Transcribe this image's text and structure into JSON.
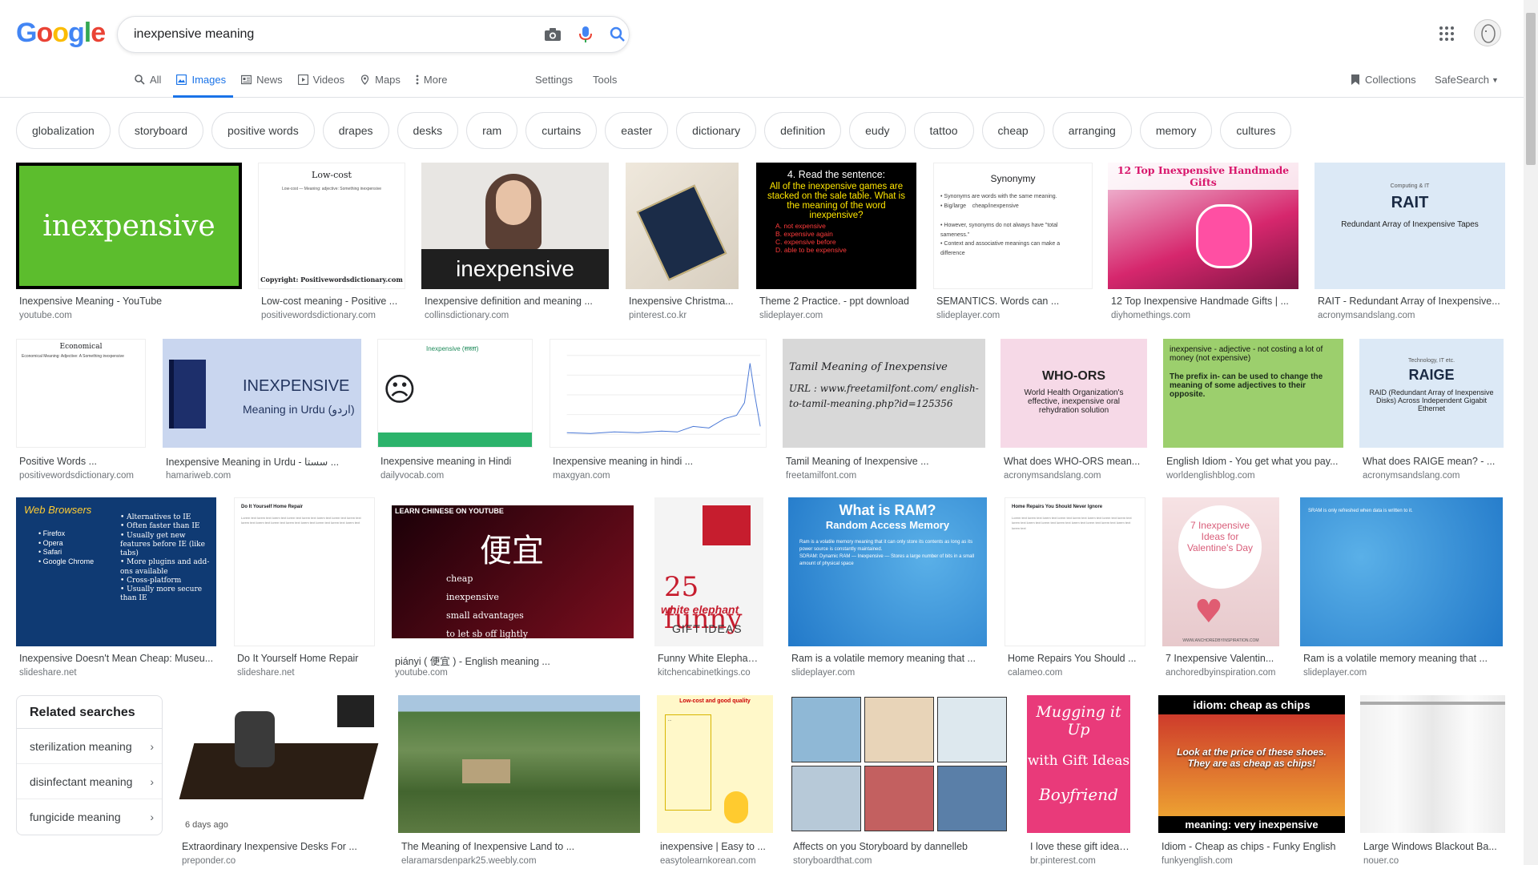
{
  "logo_letters": [
    "G",
    "o",
    "o",
    "g",
    "l",
    "e"
  ],
  "logo_colors": [
    "#4285F4",
    "#EA4335",
    "#FBBC05",
    "#4285F4",
    "#34A853",
    "#EA4335"
  ],
  "search": {
    "value": "inexpensive meaning"
  },
  "tabs": [
    {
      "label": "All",
      "icon": "search-icon",
      "active": false
    },
    {
      "label": "Images",
      "icon": "image-icon",
      "active": true
    },
    {
      "label": "News",
      "icon": "news-icon",
      "active": false
    },
    {
      "label": "Videos",
      "icon": "video-icon",
      "active": false
    },
    {
      "label": "Maps",
      "icon": "map-icon",
      "active": false
    },
    {
      "label": "More",
      "icon": "more-vert-icon",
      "active": false
    }
  ],
  "settings_label": "Settings",
  "tools_label": "Tools",
  "collections_label": "Collections",
  "safesearch_label": "SafeSearch",
  "chips": [
    "globalization",
    "storyboard",
    "positive words",
    "drapes",
    "desks",
    "ram",
    "curtains",
    "easter",
    "dictionary",
    "definition",
    "eudy",
    "tattoo",
    "cheap",
    "arranging",
    "memory",
    "cultures"
  ],
  "rows": [
    [
      {
        "title": "Inexpensive Meaning - YouTube",
        "source": "youtube.com",
        "img_text": "inexpensive"
      },
      {
        "title": "Low-cost meaning - Positive ...",
        "source": "positivewordsdictionary.com",
        "img_text": "Low-cost",
        "img_text2": "Copyright:  Positivewordsdictionary.com"
      },
      {
        "title": "Inexpensive definition and meaning ...",
        "source": "collinsdictionary.com",
        "img_text": "inexpensive"
      },
      {
        "title": "Inexpensive Christma...",
        "source": "pinterest.co.kr"
      },
      {
        "title": "Theme 2 Practice. - ppt download",
        "source": "slideplayer.com",
        "img_text": "4.  Read the sentence:",
        "img_text2": "All of the inexpensive games are stacked on the sale table. What is the meaning of the word inexpensive?",
        "img_options": [
          "A.   not expensive",
          "B.   expensive again",
          "C.   expensive before",
          "D.   able to be expensive"
        ]
      },
      {
        "title": "SEMANTICS. Words can ...",
        "source": "slideplayer.com",
        "img_text": "Synonymy"
      },
      {
        "title": "12 Top Inexpensive Handmade Gifts | ...",
        "source": "diyhomethings.com",
        "img_text": "12 Top Inexpensive Handmade Gifts"
      },
      {
        "title": "RAIT - Redundant Array of Inexpensive...",
        "source": "acronymsandslang.com",
        "img_text": "RAIT",
        "img_text2": "Redundant Array of Inexpensive Tapes",
        "img_text3": "Computing & IT"
      }
    ],
    [
      {
        "title": "Positive Words ...",
        "source": "positivewordsdictionary.com",
        "img_text": "Economical"
      },
      {
        "title": "Inexpensive Meaning in Urdu - سستا ...",
        "source": "hamariweb.com",
        "img_text": "INEXPENSIVE",
        "img_text2": "Meaning in Urdu (اردو)"
      },
      {
        "title": "Inexpensive meaning in Hindi",
        "source": "dailyvocab.com",
        "img_text": "Inexpensive (सस्ता)"
      },
      {
        "title": "Inexpensive meaning in hindi ...",
        "source": "maxgyan.com"
      },
      {
        "title": "Tamil Meaning of Inexpensive ...",
        "source": "freetamilfont.com",
        "img_text": "Tamil Meaning of Inexpensive",
        "img_text2": "URL : www.freetamilfont.com/ english-to-tamil-meaning.php?id=125356"
      },
      {
        "title": "What does WHO-ORS mean...",
        "source": "acronymsandslang.com",
        "img_text": "WHO-ORS",
        "img_text2": "World Health Organization's effective, inexpensive oral rehydration solution"
      },
      {
        "title": "English Idiom - You get what you pay...",
        "source": "worldenglishblog.com",
        "img_text": "inexpensive - adjective - not costing a lot of money (not expensive)",
        "img_text2": "The prefix in- can be used to change the meaning of some adjectives to their opposite."
      },
      {
        "title": "What does RAIGE mean? - ...",
        "source": "acronymsandslang.com",
        "img_text": "RAIGE",
        "img_text2": "RAID (Redundant Array of Inexpensive Disks) Across Independent Gigabit Ethernet",
        "img_text3": "Technology, IT etc."
      }
    ],
    [
      {
        "title": "Inexpensive Doesn't Mean Cheap: Museu...",
        "source": "slideshare.net",
        "img_text": "Web Browsers",
        "img_list1": [
          "• Firefox",
          "• Opera",
          "• Safari",
          "• Google Chrome"
        ],
        "img_list2": [
          "• Alternatives to IE",
          "• Often faster than IE",
          "• Usually get new features before IE (like tabs)",
          "• More plugins and add-ons available",
          "• Cross-platform",
          "• Usually more secure than IE"
        ]
      },
      {
        "title": "Do It Yourself Home Repair",
        "source": "slideshare.net",
        "img_text": "Do It Yourself Home Repair"
      },
      {
        "title": "piányi ( 便宜 ) - English meaning ...",
        "source": "youtube.com",
        "img_text": "便宜",
        "img_list1": [
          "cheap",
          "inexpensive",
          "small advantages",
          "to let sb off lightly"
        ],
        "img_text2": "LEARN CHINESE ON YOUTUBE"
      },
      {
        "title": "Funny White Elephant ...",
        "source": "kitchencabinetkings.co",
        "img_text": "25 funny",
        "img_text2": "white elephant",
        "img_text3": "GIFT IDEAS"
      },
      {
        "title": "Ram is a volatile memory meaning that ...",
        "source": "slideplayer.com",
        "img_text": "What is RAM?",
        "img_text2": "Random Access Memory"
      },
      {
        "title": "Home Repairs You Should ...",
        "source": "calameo.com",
        "img_text": "Home Repairs You Should Never Ignore"
      },
      {
        "title": "7 Inexpensive Valentin...",
        "source": "anchoredbyinspiration.com",
        "img_text": "7 Inexpensive Ideas for Valentine's Day",
        "img_text2": "WWW.ANCHOREDBYINSPIRATION.COM"
      },
      {
        "title": "Ram is a volatile memory meaning that ...",
        "source": "slideplayer.com",
        "img_text": "SRAM is only refreshed when data is written to it."
      }
    ],
    [
      {
        "title": "Extraordinary Inexpensive Desks For ...",
        "source": "preponder.co",
        "badge": "6 days ago"
      },
      {
        "title": "The Meaning of Inexpensive Land to ...",
        "source": "elaramarsdenpark25.weebly.com"
      },
      {
        "title": "inexpensive | Easy to ...",
        "source": "easytolearnkorean.com",
        "img_text": "Low-cost and good quality"
      },
      {
        "title": "Affects on you Storyboard by dannelleb",
        "source": "storyboardthat.com"
      },
      {
        "title": "I love these gift ideas f...",
        "source": "br.pinterest.com",
        "img_text": "Mugging it Up",
        "img_text2": "with Gift Ideas",
        "img_text3": "Boyfriend"
      },
      {
        "title": "Idiom - Cheap as chips - Funky English",
        "source": "funkyenglish.com",
        "img_text": "idiom: cheap as chips",
        "img_text2": "Look at the price of these shoes. They are as cheap as chips!",
        "img_text3": "meaning: very inexpensive"
      },
      {
        "title": "Large Windows Blackout Ba...",
        "source": "nouer.co"
      }
    ]
  ],
  "related": {
    "title": "Related searches",
    "items": [
      "sterilization meaning",
      "disinfectant meaning",
      "fungicide meaning"
    ]
  },
  "colors": {
    "accent": "#1a73e8",
    "border": "#dfe1e5"
  }
}
